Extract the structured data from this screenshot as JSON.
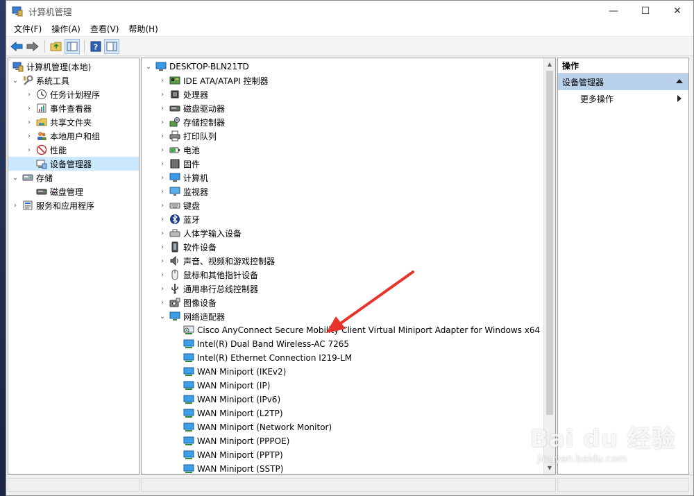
{
  "window": {
    "title": "计算机管理",
    "controls": {
      "minimize": "—",
      "maximize": "☐",
      "close": "✕"
    }
  },
  "menu": [
    "文件(F)",
    "操作(A)",
    "查看(V)",
    "帮助(H)"
  ],
  "left_tree": [
    {
      "label": "计算机管理(本地)",
      "level": 0,
      "expander": "",
      "icon": "computer-management-icon"
    },
    {
      "label": "系统工具",
      "level": 1,
      "expander": "⌄",
      "icon": "system-tools-icon"
    },
    {
      "label": "任务计划程序",
      "level": 2,
      "expander": "›",
      "icon": "task-scheduler-icon"
    },
    {
      "label": "事件查看器",
      "level": 2,
      "expander": "›",
      "icon": "event-viewer-icon"
    },
    {
      "label": "共享文件夹",
      "level": 2,
      "expander": "›",
      "icon": "shared-folders-icon"
    },
    {
      "label": "本地用户和组",
      "level": 2,
      "expander": "›",
      "icon": "users-groups-icon"
    },
    {
      "label": "性能",
      "level": 2,
      "expander": "›",
      "icon": "performance-icon"
    },
    {
      "label": "设备管理器",
      "level": 2,
      "expander": "",
      "icon": "device-manager-icon",
      "selected": true
    },
    {
      "label": "存储",
      "level": 1,
      "expander": "⌄",
      "icon": "storage-icon"
    },
    {
      "label": "磁盘管理",
      "level": 2,
      "expander": "",
      "icon": "disk-management-icon"
    },
    {
      "label": "服务和应用程序",
      "level": 1,
      "expander": "›",
      "icon": "services-apps-icon"
    }
  ],
  "device_tree": {
    "root": "DESKTOP-BLN21TD",
    "categories": [
      {
        "label": "IDE ATA/ATAPI 控制器",
        "icon": "ide-controller-icon"
      },
      {
        "label": "处理器",
        "icon": "processor-icon"
      },
      {
        "label": "磁盘驱动器",
        "icon": "disk-drive-icon"
      },
      {
        "label": "存储控制器",
        "icon": "storage-controller-icon"
      },
      {
        "label": "打印队列",
        "icon": "print-queue-icon"
      },
      {
        "label": "电池",
        "icon": "battery-icon"
      },
      {
        "label": "固件",
        "icon": "firmware-icon"
      },
      {
        "label": "计算机",
        "icon": "computer-icon"
      },
      {
        "label": "监视器",
        "icon": "monitor-icon"
      },
      {
        "label": "键盘",
        "icon": "keyboard-icon"
      },
      {
        "label": "蓝牙",
        "icon": "bluetooth-icon"
      },
      {
        "label": "人体学输入设备",
        "icon": "hid-icon"
      },
      {
        "label": "软件设备",
        "icon": "software-device-icon"
      },
      {
        "label": "声音、视频和游戏控制器",
        "icon": "sound-icon"
      },
      {
        "label": "鼠标和其他指针设备",
        "icon": "mouse-icon"
      },
      {
        "label": "通用串行总线控制器",
        "icon": "usb-icon"
      },
      {
        "label": "图像设备",
        "icon": "imaging-icon"
      }
    ],
    "expanded": {
      "label": "网络适配器",
      "icon": "network-adapter-icon",
      "children": [
        "Cisco AnyConnect Secure Mobility Client Virtual Miniport Adapter for Windows x64",
        "Intel(R) Dual Band Wireless-AC 7265",
        "Intel(R) Ethernet Connection I219-LM",
        "WAN Miniport (IKEv2)",
        "WAN Miniport (IP)",
        "WAN Miniport (IPv6)",
        "WAN Miniport (L2TP)",
        "WAN Miniport (Network Monitor)",
        "WAN Miniport (PPPOE)",
        "WAN Miniport (PPTP)",
        "WAN Miniport (SSTP)"
      ]
    }
  },
  "actions": {
    "header": "操作",
    "section": "设备管理器",
    "link": "更多操作"
  },
  "watermark": {
    "main": "Bai du 经验",
    "sub": "jingyan.baidu.com"
  },
  "colors": {
    "selection": "#cce8ff",
    "actions_section": "#b9d1ea",
    "arrow": "#e8332a"
  }
}
